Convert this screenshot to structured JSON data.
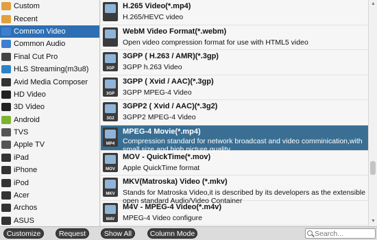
{
  "sidebar": {
    "items": [
      {
        "label": "Custom",
        "icon": "folder-icon",
        "color": "#e0a040"
      },
      {
        "label": "Recent",
        "icon": "recent-icon",
        "color": "#e0a040"
      },
      {
        "label": "Common Video",
        "icon": "common-video-icon",
        "color": "#3c7ed0",
        "active": true
      },
      {
        "label": "Common Audio",
        "icon": "common-audio-icon",
        "color": "#3c7ed0"
      },
      {
        "label": "Final Cut Pro",
        "icon": "final-cut-pro-icon",
        "color": "#444444"
      },
      {
        "label": "HLS Streaming(m3u8)",
        "icon": "hls-streaming-icon",
        "color": "#2b82c9"
      },
      {
        "label": "Avid Media Composer",
        "icon": "avid-icon",
        "color": "#333333"
      },
      {
        "label": "HD Video",
        "icon": "hd-video-icon",
        "color": "#222222"
      },
      {
        "label": "3D Video",
        "icon": "3d-video-icon",
        "color": "#222222"
      },
      {
        "label": "Android",
        "icon": "android-icon",
        "color": "#7bb431"
      },
      {
        "label": "TVS",
        "icon": "tv-icon",
        "color": "#555555"
      },
      {
        "label": "Apple TV",
        "icon": "apple-tv-icon",
        "color": "#555555"
      },
      {
        "label": "iPad",
        "icon": "ipad-icon",
        "color": "#333333"
      },
      {
        "label": "iPhone",
        "icon": "iphone-icon",
        "color": "#333333"
      },
      {
        "label": "iPod",
        "icon": "ipod-icon",
        "color": "#333333"
      },
      {
        "label": "Acer",
        "icon": "acer-icon",
        "color": "#333333"
      },
      {
        "label": "Archos",
        "icon": "archos-icon",
        "color": "#333333"
      },
      {
        "label": "ASUS",
        "icon": "asus-icon",
        "color": "#333333"
      }
    ],
    "active_color": "#2e6fb4"
  },
  "formats": [
    {
      "title": "H.265 Video(*.mp4)",
      "desc": "H.265/HEVC video",
      "icon": "h265-icon",
      "badge": ""
    },
    {
      "title": "WebM Video Format(*.webm)",
      "desc": "Open video compression format for use with HTML5 video",
      "icon": "webm-icon",
      "badge": ""
    },
    {
      "title": "3GPP ( H.263 / AMR)(*.3gp)",
      "desc": "3GPP h.263 Video",
      "icon": "3gp-icon",
      "badge": "3GP"
    },
    {
      "title": "3GPP ( Xvid / AAC)(*.3gp)",
      "desc": "3GPP MPEG-4 Video",
      "icon": "3gp-icon",
      "badge": "3GP"
    },
    {
      "title": "3GPP2 ( Xvid / AAC)(*.3g2)",
      "desc": "3GPP2 MPEG-4 Video",
      "icon": "3g2-icon",
      "badge": "3G2"
    },
    {
      "title": "MPEG-4 Movie(*.mp4)",
      "desc": "Compression standard for network broadcast and video comminication,with small size and high picture quality",
      "icon": "mp4-icon",
      "badge": "MP4",
      "selected": true
    },
    {
      "title": "MOV - QuickTime(*.mov)",
      "desc": "Apple QuickTime format",
      "icon": "mov-icon",
      "badge": "MOV"
    },
    {
      "title": "MKV(Matroska) Video (*.mkv)",
      "desc": "Stands for Matroska Video,it is described by its developers as the extensible open standard Audio/Video Container",
      "icon": "mkv-icon",
      "badge": "MKV"
    },
    {
      "title": "M4V - MPEG-4 Video(*.m4v)",
      "desc": "MPEG-4 Video configure",
      "icon": "m4v-icon",
      "badge": "M4V"
    }
  ],
  "bottom": {
    "customize": "Customize",
    "request": "Request",
    "show_all": "Show All",
    "column_mode": "Column Mode",
    "search_placeholder": "Search..."
  },
  "colors": {
    "selected_row": "#3a6f93",
    "button_bg": "#3f3f3f"
  }
}
